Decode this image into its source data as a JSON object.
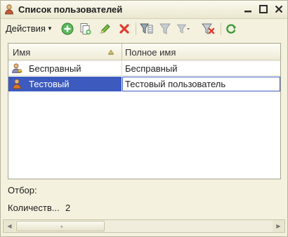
{
  "window": {
    "title": "Список пользователей"
  },
  "toolbar": {
    "actions_label": "Действия"
  },
  "grid": {
    "columns": [
      "Имя",
      "Полное имя"
    ],
    "rows": [
      {
        "name": "Бесправный",
        "full_name": "Бесправный",
        "icon": "user-restricted-icon",
        "selected": false
      },
      {
        "name": "Тестовый",
        "full_name": "Тестовый пользователь",
        "icon": "user-icon",
        "selected": true
      }
    ]
  },
  "footer": {
    "filter_label": "Отбор:",
    "count_label": "Количеств...",
    "count_value": "2"
  },
  "colors": {
    "selection": "#3d5bbf",
    "window_bg": "#f4f1de"
  }
}
